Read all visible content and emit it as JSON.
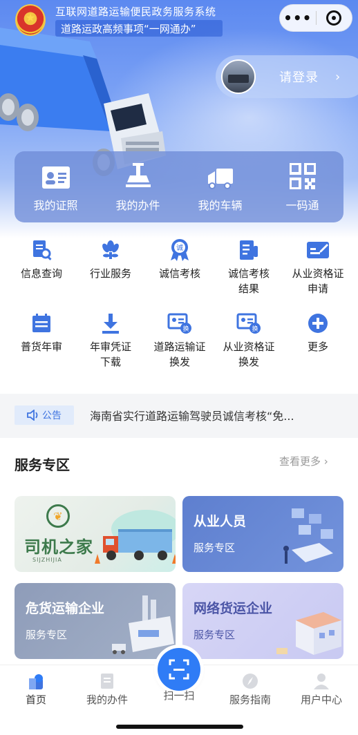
{
  "header": {
    "system_title": "互联网道路运输便民政务服务系统",
    "system_subtitle": "道路运政高频事项“一网通办”",
    "capsule_more": "•••",
    "login_label": "请登录",
    "login_arrow": "›"
  },
  "quick_actions": [
    {
      "label": "我的证照",
      "icon": "id-card-icon"
    },
    {
      "label": "我的办件",
      "icon": "stamp-icon"
    },
    {
      "label": "我的车辆",
      "icon": "truck-icon"
    },
    {
      "label": "一码通",
      "icon": "qr-code-icon"
    }
  ],
  "services": [
    {
      "label": "信息查询",
      "icon": "doc-search-icon"
    },
    {
      "label": "行业服务",
      "icon": "flower-icon"
    },
    {
      "label": "诚信考核",
      "icon": "medal-icon",
      "badge": "诚"
    },
    {
      "label": "诚信考核结果",
      "line1": "诚信考核",
      "line2": "结果",
      "icon": "doc-result-icon"
    },
    {
      "label": "从业资格证申请",
      "line1": "从业资格证",
      "line2": "申请",
      "icon": "edit-card-icon"
    },
    {
      "label": "普货年审",
      "icon": "calendar-icon"
    },
    {
      "label": "年审凭证下载",
      "line1": "年审凭证",
      "line2": "下载",
      "icon": "download-icon"
    },
    {
      "label": "道路运输证换发",
      "line1": "道路运输证",
      "line2": "换发",
      "icon": "card-exchange-icon",
      "badge": "换"
    },
    {
      "label": "从业资格证换发",
      "line1": "从业资格证",
      "line2": "换发",
      "icon": "card-exchange-icon",
      "badge": "换"
    },
    {
      "label": "更多",
      "icon": "plus-circle-icon"
    }
  ],
  "notice": {
    "tag": "公告",
    "text": "海南省实行道路运输驾驶员诚信考核“免..."
  },
  "service_zone": {
    "title": "服务专区",
    "more": "查看更多 ›",
    "cards": [
      {
        "title": "司机之家",
        "subtitle": "SIJZHIJIA"
      },
      {
        "title": "从业人员",
        "subtitle": "服务专区"
      },
      {
        "title": "危货运输企业",
        "subtitle": "服务专区"
      },
      {
        "title": "网络货运企业",
        "subtitle": "服务专区"
      }
    ]
  },
  "tabbar": {
    "items": [
      {
        "label": "首页"
      },
      {
        "label": "我的办件"
      },
      {
        "label": "扫一扫"
      },
      {
        "label": "服务指南"
      },
      {
        "label": "用户中心"
      }
    ]
  },
  "colors": {
    "primary": "#2f7cf6",
    "icon_blue": "#3f74e0",
    "hero_top": "#5c89f0",
    "green_brand": "#3d7a4c"
  }
}
